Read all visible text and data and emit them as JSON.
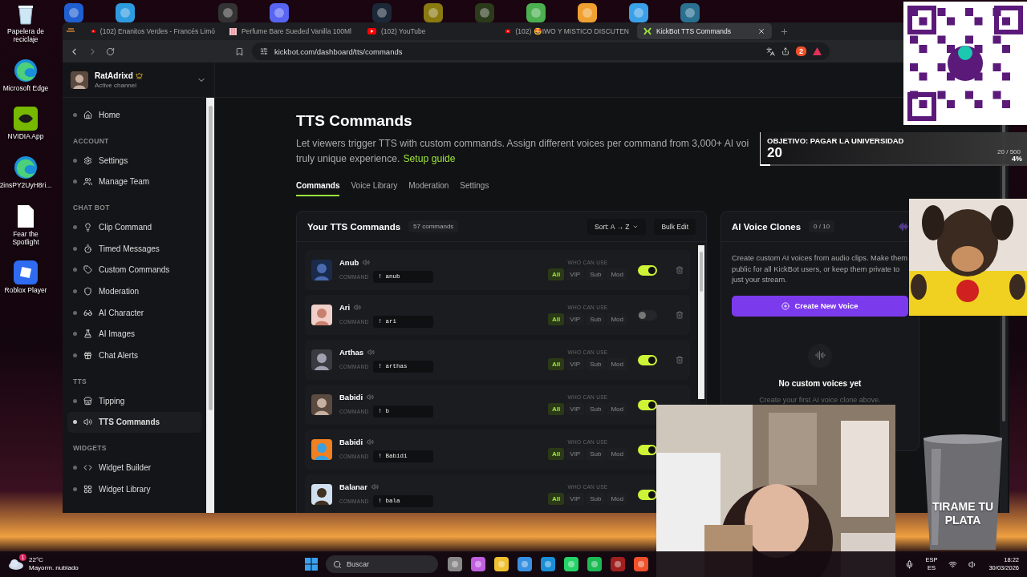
{
  "desktop_icons": [
    {
      "label": "Papelera de reciclaje",
      "kind": "recycle"
    },
    {
      "label": "Microsoft Edge",
      "kind": "edge"
    },
    {
      "label": "NVIDIA App",
      "kind": "nvidia"
    },
    {
      "label": "2insPY2UyH8ri...",
      "kind": "edge"
    },
    {
      "label": "Fear the Spotlight",
      "kind": "file"
    },
    {
      "label": "Roblox Player",
      "kind": "roblox"
    }
  ],
  "browser": {
    "tabs": [
      {
        "title": "(102) Enanitos Verdes - Francés Limó",
        "kind": "video",
        "selected": false
      },
      {
        "title": "Perfume Bare Sueded Vanilla 100Ml",
        "kind": "shop",
        "selected": false
      },
      {
        "title": "(102) YouTube",
        "kind": "video",
        "selected": false
      },
      {
        "title": "(102) 🤩IWO Y MISTICO DISCUTEN",
        "kind": "video",
        "selected": false
      },
      {
        "title": "KickBot TTS Commands",
        "kind": "app",
        "selected": true
      }
    ],
    "url": "kickbot.com/dashboard/tts/commands",
    "shield_count": "2"
  },
  "channel": {
    "name": "RatAdrixd",
    "status": "Active channel"
  },
  "sidebar": {
    "sections": [
      {
        "items": [
          {
            "label": "Home",
            "kind": "home",
            "selected": false
          }
        ]
      },
      {
        "heading": "ACCOUNT",
        "items": [
          {
            "label": "Settings",
            "kind": "gear",
            "selected": false
          },
          {
            "label": "Manage Team",
            "kind": "team",
            "selected": false
          }
        ]
      },
      {
        "heading": "CHAT BOT",
        "items": [
          {
            "label": "Clip Command",
            "kind": "bulb",
            "selected": false
          },
          {
            "label": "Timed Messages",
            "kind": "timer",
            "selected": false
          },
          {
            "label": "Custom Commands",
            "kind": "tag",
            "selected": false
          },
          {
            "label": "Moderation",
            "kind": "shield",
            "selected": false
          },
          {
            "label": "AI Character",
            "kind": "glasses",
            "selected": false
          },
          {
            "label": "AI Images",
            "kind": "flask",
            "selected": false
          },
          {
            "label": "Chat Alerts",
            "kind": "gift",
            "selected": false
          }
        ]
      },
      {
        "heading": "TTS",
        "items": [
          {
            "label": "Tipping",
            "kind": "store",
            "selected": false
          },
          {
            "label": "TTS Commands",
            "kind": "speaker",
            "selected": true
          }
        ]
      },
      {
        "heading": "WIDGETS",
        "items": [
          {
            "label": "Widget Builder",
            "kind": "code",
            "selected": false
          },
          {
            "label": "Widget Library",
            "kind": "grid",
            "selected": false
          }
        ]
      }
    ]
  },
  "page": {
    "title": "TTS Commands",
    "description_lines": [
      "Let viewers trigger TTS with custom commands. Assign different voices per command from 3,000+ AI voi",
      "truly unique experience."
    ],
    "guide_link": "Setup guide",
    "tabs": [
      {
        "label": "Commands",
        "selected": true
      },
      {
        "label": "Voice Library",
        "selected": false
      },
      {
        "label": "Moderation",
        "selected": false
      },
      {
        "label": "Settings",
        "selected": false
      }
    ]
  },
  "commands_card": {
    "title": "Your TTS Commands",
    "count": "57 commands",
    "sort": "Sort: A → Z",
    "bulk_edit": "Bulk Edit",
    "rows": [
      {
        "name": "Anub",
        "command_label": "COMMAND",
        "command": "! anub",
        "who_label": "WHO CAN USE",
        "enabled": true,
        "roles": [
          {
            "label": "All",
            "selected": true
          },
          {
            "label": "VIP",
            "selected": false
          },
          {
            "label": "Sub",
            "selected": false
          },
          {
            "label": "Mod",
            "selected": false
          }
        ]
      },
      {
        "name": "Ari",
        "command_label": "COMMAND",
        "command": "! ari",
        "who_label": "WHO CAN USE",
        "enabled": false,
        "roles": [
          {
            "label": "All",
            "selected": true
          },
          {
            "label": "VIP",
            "selected": false
          },
          {
            "label": "Sub",
            "selected": false
          },
          {
            "label": "Mod",
            "selected": false
          }
        ]
      },
      {
        "name": "Arthas",
        "command_label": "COMMAND",
        "command": "! arthas",
        "who_label": "WHO CAN USE",
        "enabled": true,
        "roles": [
          {
            "label": "All",
            "selected": true
          },
          {
            "label": "VIP",
            "selected": false
          },
          {
            "label": "Sub",
            "selected": false
          },
          {
            "label": "Mod",
            "selected": false
          }
        ]
      },
      {
        "name": "Babidi",
        "command_label": "COMMAND",
        "command": "! b",
        "who_label": "WHO CAN USE",
        "enabled": true,
        "roles": [
          {
            "label": "All",
            "selected": true
          },
          {
            "label": "VIP",
            "selected": false
          },
          {
            "label": "Sub",
            "selected": false
          },
          {
            "label": "Mod",
            "selected": false
          }
        ]
      },
      {
        "name": "Babidi",
        "command_label": "COMMAND",
        "command": "! Babidi",
        "who_label": "WHO CAN USE",
        "enabled": true,
        "roles": [
          {
            "label": "All",
            "selected": true
          },
          {
            "label": "VIP",
            "selected": false
          },
          {
            "label": "Sub",
            "selected": false
          },
          {
            "label": "Mod",
            "selected": false
          }
        ]
      },
      {
        "name": "Balanar",
        "command_label": "COMMAND",
        "command": "! bala",
        "who_label": "WHO CAN USE",
        "enabled": true,
        "roles": [
          {
            "label": "All",
            "selected": true
          },
          {
            "label": "VIP",
            "selected": false
          },
          {
            "label": "Sub",
            "selected": false
          },
          {
            "label": "Mod",
            "selected": false
          }
        ]
      }
    ]
  },
  "clones_card": {
    "title": "AI Voice Clones",
    "count": "0 / 10",
    "description": "Create custom AI voices from audio clips. Make them public for all KickBot users, or keep them private to just your stream.",
    "button": "Create New Voice",
    "empty_title": "No custom voices yet",
    "empty_text": "Create your first AI voice clone above."
  },
  "goal_overlay": {
    "title": "OBJETIVO: PAGAR LA UNIVERSIDAD",
    "amount": "20",
    "progress": "20 / 500",
    "percent": "4%",
    "level": 0.04
  },
  "tip_overlay": {
    "text": "TIRAME TU PLATA"
  },
  "taskbar": {
    "weather_badge": "1",
    "temperature": "22°C",
    "weather": "Mayorm. nublado",
    "search_placeholder": "Buscar",
    "lang_top": "ESP",
    "lang_bottom": "ES",
    "time": "18:22",
    "date": "30/03/2026"
  }
}
